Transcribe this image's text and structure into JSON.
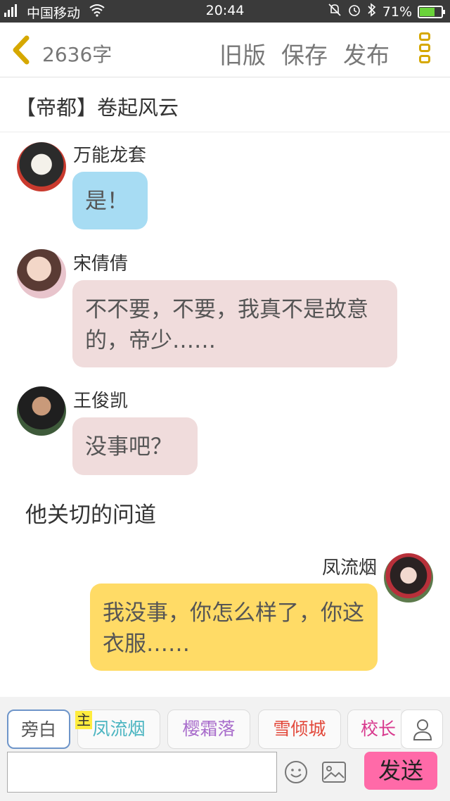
{
  "status_bar": {
    "network": "2G",
    "carrier": "中国移动",
    "time": "20:44",
    "battery": "71%",
    "battery_level": 0.71
  },
  "header": {
    "word_count": "2636字",
    "old_version": "旧版",
    "save": "保存",
    "publish": "发布"
  },
  "chapter_title": "【帝都】卷起风云",
  "messages": [
    {
      "name": "万能龙套",
      "text": "是！",
      "side": "left",
      "bubble_color": "#a7dcf3"
    },
    {
      "name": "宋倩倩",
      "text": "不不要，不要，我真不是故意的，帝少……",
      "side": "left",
      "bubble_color": "#f0dcdc"
    },
    {
      "name": "王俊凯",
      "text": "没事吧？",
      "side": "left",
      "bubble_color": "#f0dcdc"
    },
    {
      "name": "凤流烟",
      "text": "我没事，你怎么样了，你这衣服……",
      "side": "right",
      "bubble_color": "#ffdb66"
    }
  ],
  "narration": "他关切的问道",
  "roles": {
    "narration": "旁白",
    "main_badge": "主",
    "role_1": "凤流烟",
    "role_2": "樱霜落",
    "role_3": "雪倾城",
    "role_4": "校长"
  },
  "input": {
    "value": "",
    "placeholder": ""
  },
  "send": "发送",
  "colors": {
    "accent_yellow": "#d6a800",
    "send_pink": "#ff6aa8",
    "narration_tab_border": "#6e95c9"
  }
}
